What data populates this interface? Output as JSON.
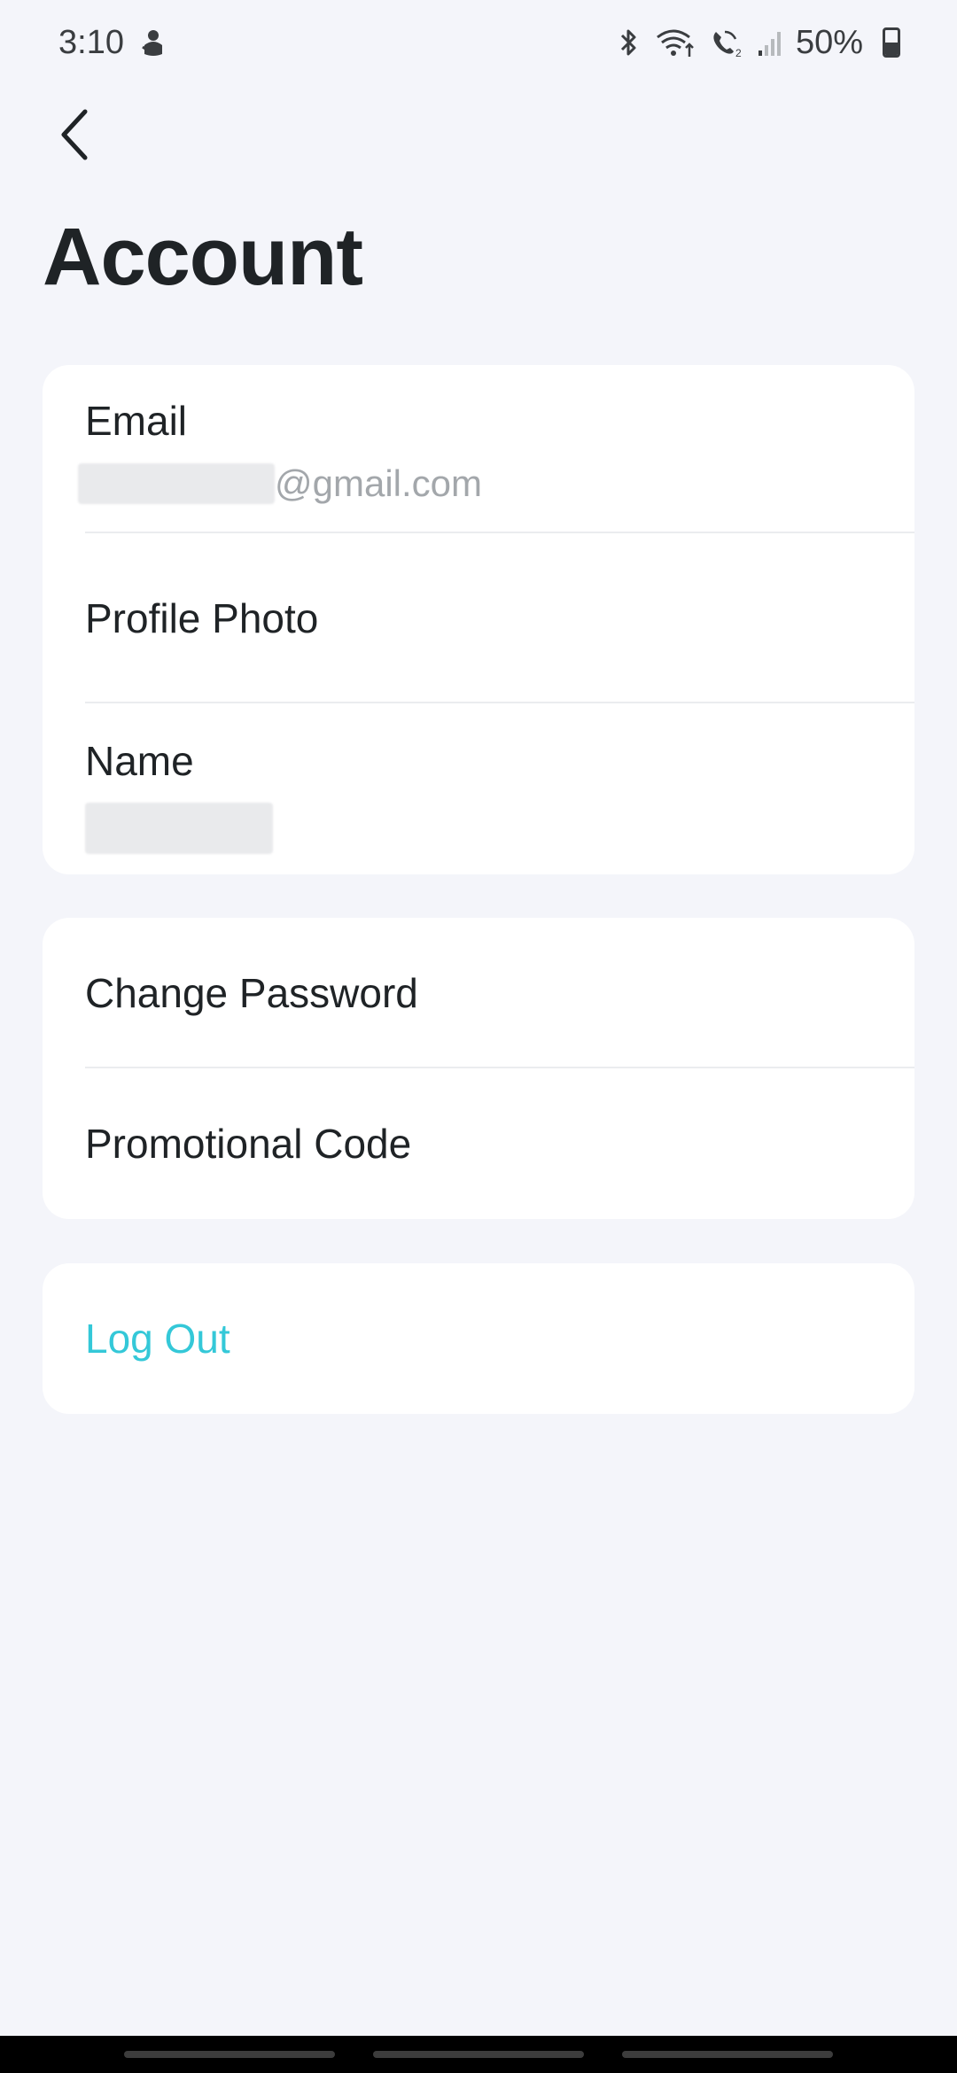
{
  "status_bar": {
    "time": "3:10",
    "battery_percent": "50%",
    "battery_level": 0.5,
    "icons": [
      "android-robot-icon",
      "bluetooth-icon",
      "wifi-calling-icon",
      "vowifi-icon",
      "signal-icon",
      "battery-icon"
    ]
  },
  "header": {
    "back_icon": "chevron-left-icon",
    "title": "Account"
  },
  "account_card": {
    "email_label": "Email",
    "email_value_suffix": "@gmail.com",
    "profile_photo_label": "Profile Photo",
    "name_label": "Name"
  },
  "security_card": {
    "change_password_label": "Change Password",
    "promotional_code_label": "Promotional Code"
  },
  "logout_card": {
    "logout_label": "Log Out"
  },
  "colors": {
    "background": "#f4f5fa",
    "card": "#ffffff",
    "accent": "#34c8d8",
    "text_primary": "#1f2326",
    "text_secondary": "#a3a7ab"
  }
}
